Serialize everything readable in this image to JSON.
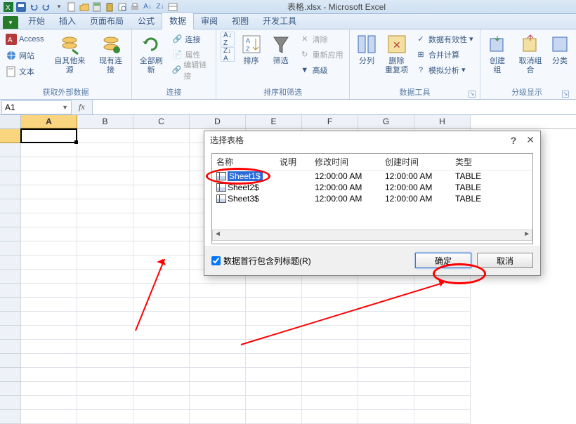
{
  "app": {
    "title": "表格.xlsx - Microsoft Excel"
  },
  "tabs": {
    "start": "开始",
    "insert": "插入",
    "layout": "页面布局",
    "formula": "公式",
    "data": "数据",
    "review": "审阅",
    "view": "视图",
    "dev": "开发工具"
  },
  "ribbon": {
    "g1_label": "获取外部数据",
    "access": "Access",
    "web": "网站",
    "text": "文本",
    "other": "自其他来源",
    "existing": "现有连接",
    "g2_label": "连接",
    "refresh": "全部刷新",
    "conn": "连接",
    "prop": "属性",
    "editlink": "编辑链接",
    "g3_label": "排序和筛选",
    "sort": "排序",
    "filter": "筛选",
    "clear": "清除",
    "reapply": "重新应用",
    "advanced": "高级",
    "g4_label": "数据工具",
    "split": "分列",
    "dedup": "删除\n重复项",
    "validate": "数据有效性",
    "consolidate": "合并计算",
    "whatif": "模拟分析",
    "g5_label": "分级显示",
    "group": "创建组",
    "ungroup": "取消组合",
    "subtotal": "分类"
  },
  "cellref": "A1",
  "colheads": [
    "A",
    "B",
    "C",
    "D",
    "E",
    "F",
    "G",
    "H"
  ],
  "dialog": {
    "title": "选择表格",
    "cols": {
      "name": "名称",
      "desc": "说明",
      "modified": "修改时间",
      "created": "创建时间",
      "type": "类型"
    },
    "rows": [
      {
        "name": "Sheet1$",
        "desc": "",
        "modified": "12:00:00 AM",
        "created": "12:00:00 AM",
        "type": "TABLE"
      },
      {
        "name": "Sheet2$",
        "desc": "",
        "modified": "12:00:00 AM",
        "created": "12:00:00 AM",
        "type": "TABLE"
      },
      {
        "name": "Sheet3$",
        "desc": "",
        "modified": "12:00:00 AM",
        "created": "12:00:00 AM",
        "type": "TABLE"
      }
    ],
    "checkbox_label": "数据首行包含列标题(R)",
    "ok": "确定",
    "cancel": "取消"
  }
}
